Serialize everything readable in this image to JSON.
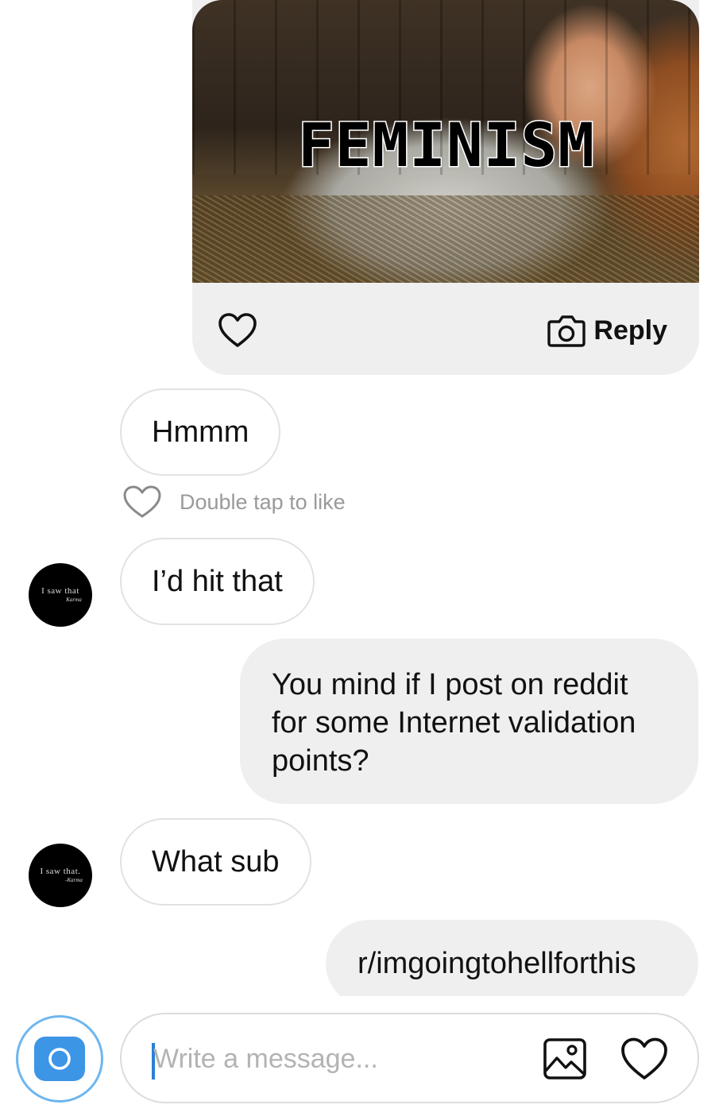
{
  "thread": {
    "image_message": {
      "caption": "FEMINISM",
      "reply_label": "Reply",
      "like_icon": "heart-outline-icon",
      "reply_icon": "camera-outline-icon"
    },
    "messages": [
      {
        "id": "m1",
        "side": "in",
        "text": "Hmmm"
      },
      {
        "id": "m2",
        "side": "in",
        "text": "I’d hit that",
        "avatar_text": "I saw that",
        "avatar_sub": "Karma"
      },
      {
        "id": "m3",
        "side": "out",
        "lines": [
          "You mind if I post on reddit",
          "for some Internet validation",
          "points?"
        ]
      },
      {
        "id": "m4",
        "side": "in",
        "text": "What sub",
        "avatar_text": "I saw that.",
        "avatar_sub": "-Karma"
      },
      {
        "id": "m5",
        "side": "out",
        "text": "r/imgoingtohellforthis"
      }
    ],
    "double_tap_hint": "Double tap to like"
  },
  "composer": {
    "placeholder": "Write a message...",
    "value": "",
    "camera_icon": "camera-icon",
    "gallery_icon": "image-gallery-icon",
    "like_icon": "heart-outline-icon"
  },
  "colors": {
    "accent_blue": "#3d95e6",
    "bubble_out_bg": "#efefef",
    "bubble_in_border": "#e2e2e2",
    "hint_gray": "#9a9a9a"
  }
}
